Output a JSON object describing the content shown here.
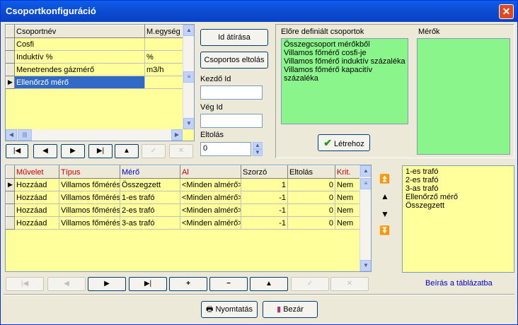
{
  "window": {
    "title": "Csoportkonfiguráció"
  },
  "top_grid": {
    "headers": [
      "Csoportnév",
      "M.egység"
    ],
    "rows": [
      [
        "Cosfi",
        ""
      ],
      [
        "Induktív %",
        "%"
      ],
      [
        "Menetrendes gázmérő",
        "m3/h"
      ],
      [
        "Ellenőrző mérő",
        ""
      ]
    ]
  },
  "buttons": {
    "rename": "Id átírása",
    "delete_group": "Csoportos eltolás",
    "create": "Létrehoz",
    "print": "Nyomtatás",
    "close": "Bezár"
  },
  "fields": {
    "start_label": "Kezdő Id",
    "start_value": "",
    "end_label": "Vég Id",
    "end_value": "",
    "offset_label": "Eltolás",
    "offset_value": "0"
  },
  "predefined": {
    "title": "Előre definiált csoportok",
    "items": [
      "Összegcsoport mérőkből",
      "Villamos főmérő cosfi-je",
      "Villamos főmérő induktív százaléka",
      "Villamos főmérő kapacitív százaléka"
    ]
  },
  "meters": {
    "title": "Mérők"
  },
  "bottom_grid": {
    "headers": [
      "Művelet",
      "Típus",
      "Mérő",
      "Al",
      "Szorzó",
      "Eltolás",
      "Krit."
    ],
    "rows": [
      [
        "Hozzáad",
        "Villamos főmérés",
        "Összegzett",
        "<Minden almérő>",
        "1",
        "0",
        "Nem"
      ],
      [
        "Hozzáad",
        "Villamos főmérés",
        "1-es trafó",
        "<Minden almérő>",
        "-1",
        "0",
        "Nem"
      ],
      [
        "Hozzáad",
        "Villamos főmérés",
        "2-es trafó",
        "<Minden almérő>",
        "-1",
        "0",
        "Nem"
      ],
      [
        "Hozzáad",
        "Villamos főmérés",
        "3-as trafó",
        "<Minden almérő>",
        "-1",
        "0",
        "Nem"
      ]
    ]
  },
  "right_list": {
    "items": [
      "1-es trafó",
      "2-es trafó",
      "3-as trafó",
      "Ellenőrző mérő",
      "Összegzett"
    ],
    "footer": "Beírás a táblázatba"
  },
  "colors": {
    "grid_bg": "#ffff9b",
    "green_list": "#8af58a",
    "title_bar": "#0c4fd6",
    "selected_row": "#316ac5"
  }
}
